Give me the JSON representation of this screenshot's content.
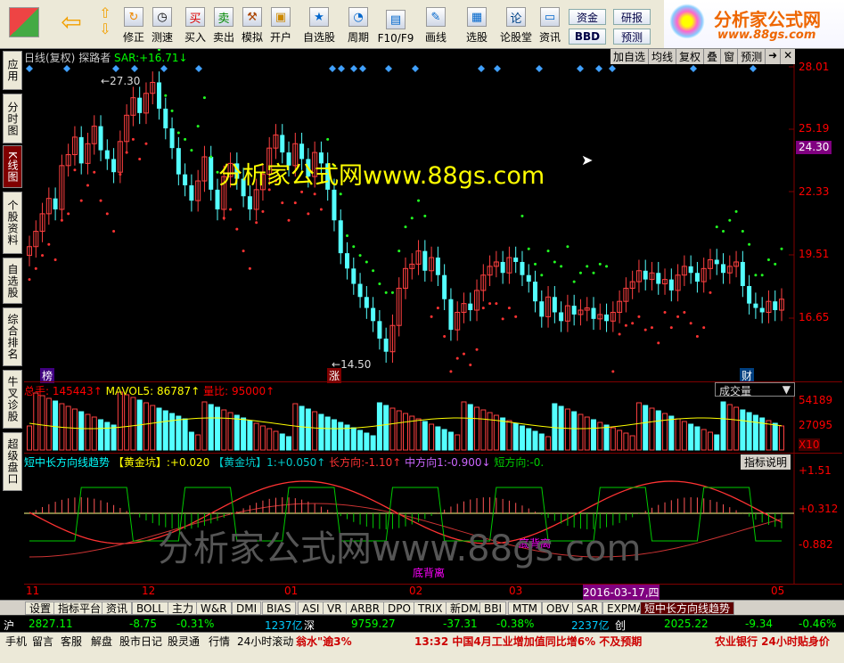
{
  "toolbar": {
    "buttons": [
      {
        "label": "",
        "icon": "stock-icon"
      },
      {
        "label": "",
        "icon": "back-arrow-icon"
      },
      {
        "label": "",
        "icon": "updown-arrow-icon"
      },
      {
        "label": "修正",
        "icon": "correct-icon"
      },
      {
        "label": "测速",
        "icon": "clock-icon"
      },
      {
        "label": "买入",
        "icon": "buy-icon",
        "glyph": "买"
      },
      {
        "label": "卖出",
        "icon": "sell-icon",
        "glyph": "卖"
      },
      {
        "label": "模拟",
        "icon": "hammer-icon"
      },
      {
        "label": "开户",
        "icon": "lock-icon"
      },
      {
        "label": "自选股",
        "icon": "star-icon"
      },
      {
        "label": "周期",
        "icon": "period-icon"
      },
      {
        "label": "F10/F9",
        "icon": "f10-icon"
      },
      {
        "label": "画线",
        "icon": "pencil-icon"
      },
      {
        "label": "选股",
        "icon": "screen-icon"
      },
      {
        "label": "论股堂",
        "icon": "forum-icon",
        "glyph": "论"
      },
      {
        "label": "资讯",
        "icon": "news-icon"
      }
    ],
    "small_buttons": [
      "资金",
      "研报",
      "BBD",
      "预测"
    ],
    "logo_text": "分析家公式网",
    "logo_url": "www.88gs.com"
  },
  "left_tabs": [
    "应用",
    "分时图",
    "K线图",
    "个股资料",
    "自选股",
    "综合排名",
    "牛叉诊股",
    "超级盘口"
  ],
  "chart": {
    "header": "日线(复权)",
    "indicator": "探路者",
    "sar_label": "SAR:",
    "sar_value": "+16.71",
    "right_buttons": [
      "加自选",
      "均线",
      "复权",
      "叠",
      "窗",
      "预测"
    ],
    "price_ticks": [
      "28.01",
      "25.19",
      "22.33",
      "19.51",
      "16.65"
    ],
    "current_price": "24.30",
    "high_label": "27.30",
    "low_label": "14.50",
    "marker_left": "榜",
    "marker_mid": "涨",
    "marker_right": "财",
    "watermark": "分析家公式网www.88gs.com",
    "watermark2": "分析家公式网www.88gs.com",
    "volume_labels": {
      "total": "总手:",
      "total_value": "145443",
      "mavol": "MAVOL5:",
      "mavol_value": "86787",
      "ratio": "量比:",
      "ratio_value": "95000",
      "select": "成交量",
      "ticks": [
        "54189",
        "27095",
        "X10"
      ]
    },
    "ind_labels": {
      "name": "短中长方向线趋势",
      "p1": "【黄金坑】:",
      "v1": "+0.020",
      "p2": "【黄金坑】1:",
      "v2": "+0.050",
      "p3": "长方向:",
      "v3": "-1.10",
      "p4": "中方向1:",
      "v4": "-0.900",
      "p5": "短方向:",
      "v5": "-0.",
      "explain": "指标说明",
      "ticks": [
        "+1.51",
        "+0.312",
        "-0.882"
      ],
      "bottom_label": "底背离",
      "bottom_label2": "底背离"
    },
    "date_axis": [
      "11",
      "12",
      "01",
      "02",
      "03",
      "2016-03-17,四",
      "05"
    ]
  },
  "bottom_tabs": [
    "设置",
    "指标平台",
    "资讯",
    "BOLL",
    "主力",
    "W&R",
    "DMI",
    "BIAS",
    "ASI",
    "VR",
    "ARBR",
    "DPO",
    "TRIX",
    "新DMA",
    "BBI",
    "MTM",
    "OBV",
    "SAR",
    "EXPMA",
    "短中长方向线趋势"
  ],
  "ticker": {
    "sh_label": "沪",
    "sh_value": "2827.11",
    "sh_change": "-8.75",
    "sh_pct": "-0.31%",
    "sh_amount": "1237亿",
    "sz_label": "深",
    "sz_value": "9759.27",
    "sz_change": "-37.31",
    "sz_pct": "-0.38%",
    "sz_amount": "2237亿",
    "cy_label": "创",
    "cy_value": "2025.22",
    "cy_change": "-9.34",
    "cy_pct": "-0.46%"
  },
  "status": {
    "items": [
      "手机",
      "留言",
      "客服",
      "解盘",
      "股市日记",
      "股灵通",
      "行情",
      "24小时滚动"
    ],
    "news1": "翁水\"逾3%",
    "news2": "13:32 中国4月工业增加值同比增6% 不及预期",
    "news3": "农业银行 24小时贴身价"
  },
  "chart_data": {
    "type": "candlestick",
    "title": "日线(复权) 探路者",
    "ylim": [
      14.5,
      28.01
    ],
    "y_ticks": [
      28.01,
      25.19,
      22.33,
      19.51,
      16.65
    ],
    "x_ticks": [
      "11",
      "12",
      "01",
      "02",
      "03",
      "2016-03-17,四",
      "05"
    ],
    "series": [
      {
        "name": "SAR",
        "value": 16.71
      }
    ],
    "high": 27.3,
    "low": 14.5,
    "current": 24.3
  }
}
